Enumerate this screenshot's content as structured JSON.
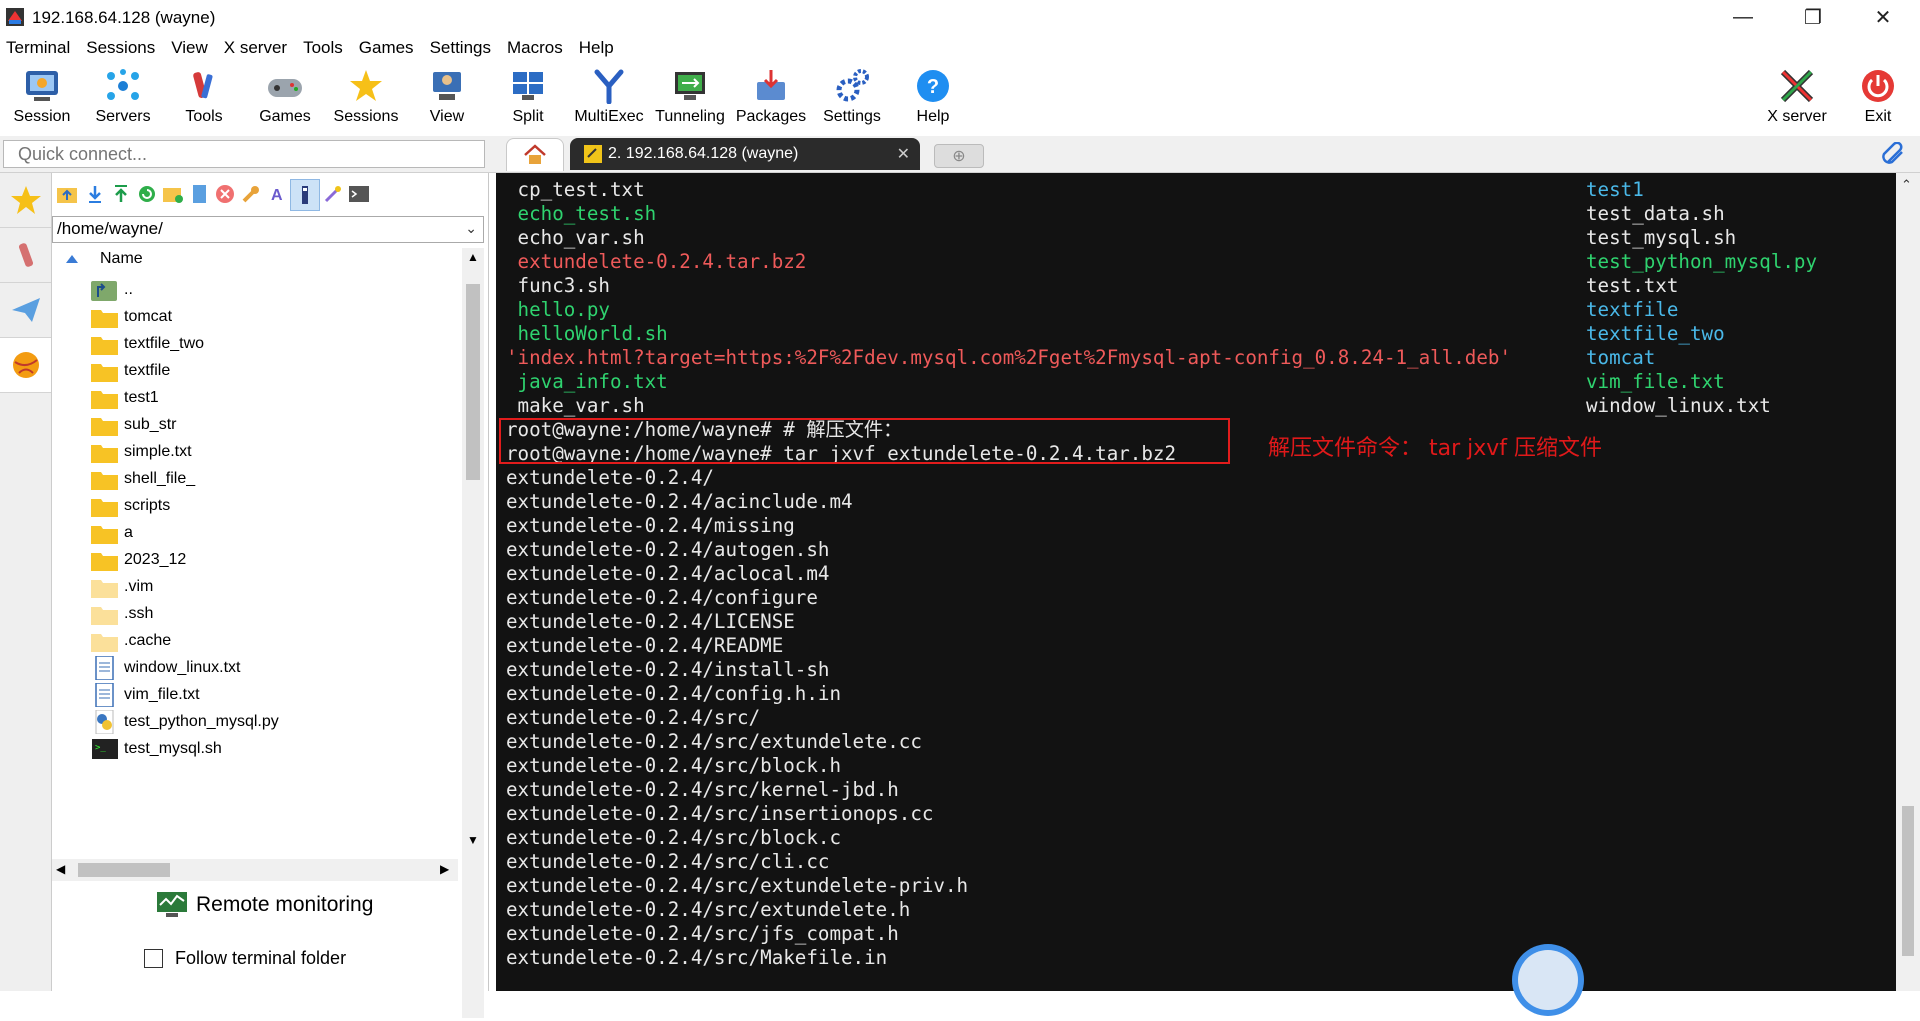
{
  "window": {
    "title": "192.168.64.128 (wayne)",
    "minimize_glyph": "—",
    "restore_glyph": "❐",
    "close_glyph": "✕"
  },
  "menu": [
    "Terminal",
    "Sessions",
    "View",
    "X server",
    "Tools",
    "Games",
    "Settings",
    "Macros",
    "Help"
  ],
  "toolbar": {
    "session": "Session",
    "servers": "Servers",
    "tools": "Tools",
    "games": "Games",
    "sessions": "Sessions",
    "view": "View",
    "split": "Split",
    "multiexec": "MultiExec",
    "tunneling": "Tunneling",
    "packages": "Packages",
    "settings": "Settings",
    "help": "Help",
    "xserver": "X server",
    "exit": "Exit"
  },
  "quick_connect": {
    "placeholder": "Quick connect..."
  },
  "tabs": {
    "session_tab": "2. 192.168.64.128 (wayne)",
    "close_glyph": "✕",
    "new_tab_glyph": "⊕"
  },
  "browser": {
    "path": "/home/wayne/",
    "column_name": "Name",
    "files": [
      {
        "name": "..",
        "type": "parent"
      },
      {
        "name": "tomcat",
        "type": "folder"
      },
      {
        "name": "textfile_two",
        "type": "folder"
      },
      {
        "name": "textfile",
        "type": "folder"
      },
      {
        "name": "test1",
        "type": "folder"
      },
      {
        "name": "sub_str",
        "type": "folder"
      },
      {
        "name": "simple.txt",
        "type": "folder"
      },
      {
        "name": "shell_file_",
        "type": "folder"
      },
      {
        "name": "scripts",
        "type": "folder"
      },
      {
        "name": "a",
        "type": "folder"
      },
      {
        "name": "2023_12",
        "type": "folder"
      },
      {
        "name": ".vim",
        "type": "hidden-folder"
      },
      {
        "name": ".ssh",
        "type": "hidden-folder"
      },
      {
        "name": ".cache",
        "type": "hidden-folder"
      },
      {
        "name": "window_linux.txt",
        "type": "doc"
      },
      {
        "name": "vim_file.txt",
        "type": "doc"
      },
      {
        "name": "test_python_mysql.py",
        "type": "python"
      },
      {
        "name": "test_mysql.sh",
        "type": "shell"
      }
    ],
    "remote_monitoring": "Remote monitoring",
    "follow_terminal_folder": "Follow terminal folder"
  },
  "colors": {
    "term_bg": "#121212",
    "term_white": "#e8e8e8",
    "term_green": "#2fd36f",
    "term_red": "#ef5a5a",
    "term_cyan": "#4ab8e8",
    "annotation_red": "#e0191a"
  },
  "terminal": {
    "left_listing": [
      {
        "text": " cp_test.txt",
        "color": "white"
      },
      {
        "text": " echo_test.sh",
        "color": "green"
      },
      {
        "text": " echo_var.sh",
        "color": "white"
      },
      {
        "text": " extundelete-0.2.4.tar.bz2",
        "color": "red"
      },
      {
        "text": " func3.sh",
        "color": "white"
      },
      {
        "text": " hello.py",
        "color": "green"
      },
      {
        "text": " helloWorld.sh",
        "color": "green"
      },
      {
        "text": "'index.html?target=https:%2F%2Fdev.mysql.com%2Fget%2Fmysql-apt-config_0.8.24-1_all.deb'",
        "color": "red"
      },
      {
        "text": " java_info.txt",
        "color": "green"
      },
      {
        "text": " make_var.sh",
        "color": "white"
      }
    ],
    "right_listing": [
      {
        "text": "test1",
        "color": "cyan"
      },
      {
        "text": "test_data.sh",
        "color": "white"
      },
      {
        "text": "test_mysql.sh",
        "color": "white"
      },
      {
        "text": "test_python_mysql.py",
        "color": "green"
      },
      {
        "text": "test.txt",
        "color": "white"
      },
      {
        "text": "textfile",
        "color": "cyan"
      },
      {
        "text": "textfile_two",
        "color": "cyan"
      },
      {
        "text": "tomcat",
        "color": "cyan"
      },
      {
        "text": "vim_file.txt",
        "color": "green"
      },
      {
        "text": "window_linux.txt",
        "color": "white"
      }
    ],
    "commands": [
      "root@wayne:/home/wayne# # 解压文件：",
      "root@wayne:/home/wayne# tar jxvf extundelete-0.2.4.tar.bz2"
    ],
    "output": [
      "extundelete-0.2.4/",
      "extundelete-0.2.4/acinclude.m4",
      "extundelete-0.2.4/missing",
      "extundelete-0.2.4/autogen.sh",
      "extundelete-0.2.4/aclocal.m4",
      "extundelete-0.2.4/configure",
      "extundelete-0.2.4/LICENSE",
      "extundelete-0.2.4/README",
      "extundelete-0.2.4/install-sh",
      "extundelete-0.2.4/config.h.in",
      "extundelete-0.2.4/src/",
      "extundelete-0.2.4/src/extundelete.cc",
      "extundelete-0.2.4/src/block.h",
      "extundelete-0.2.4/src/kernel-jbd.h",
      "extundelete-0.2.4/src/insertionops.cc",
      "extundelete-0.2.4/src/block.c",
      "extundelete-0.2.4/src/cli.cc",
      "extundelete-0.2.4/src/extundelete-priv.h",
      "extundelete-0.2.4/src/extundelete.h",
      "extundelete-0.2.4/src/jfs_compat.h",
      "extundelete-0.2.4/src/Makefile.in"
    ]
  },
  "annotation": "解压文件命令： tar jxvf 压缩文件"
}
